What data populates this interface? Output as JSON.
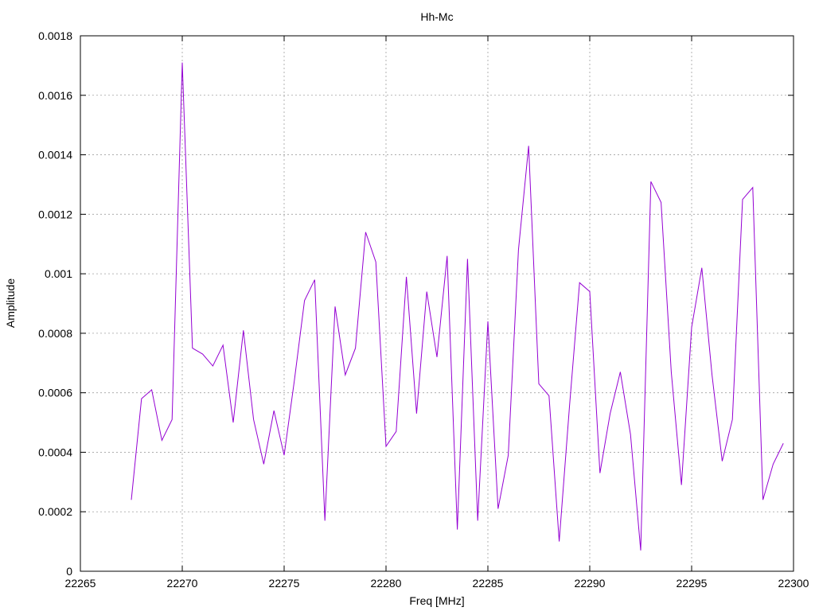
{
  "chart_data": {
    "type": "line",
    "title": "Hh-Mc",
    "xlabel": "Freq [MHz]",
    "ylabel": "Amplitude",
    "xlim": [
      22265,
      22300
    ],
    "ylim": [
      0,
      0.0018
    ],
    "xticks": [
      22265,
      22270,
      22275,
      22280,
      22285,
      22290,
      22295,
      22300
    ],
    "xtick_labels": [
      "22265",
      "22270",
      "22275",
      "22280",
      "22285",
      "22290",
      "22295",
      "22300"
    ],
    "yticks": [
      0,
      0.0002,
      0.0004,
      0.0006,
      0.0008,
      0.001,
      0.0012,
      0.0014,
      0.0016,
      0.0018
    ],
    "ytick_labels": [
      "0",
      "0.0002",
      "0.0004",
      "0.0006",
      "0.0008",
      "0.001",
      "0.0012",
      "0.0014",
      "0.0016",
      "0.0018"
    ],
    "grid": true,
    "legend": "none",
    "series": [
      {
        "color": "#9400d3",
        "x": [
          22267.5,
          22268.0,
          22268.5,
          22269.0,
          22269.5,
          22270.0,
          22270.5,
          22271.0,
          22271.5,
          22272.0,
          22272.5,
          22273.0,
          22273.5,
          22274.0,
          22274.5,
          22275.0,
          22275.5,
          22276.0,
          22276.5,
          22277.0,
          22277.5,
          22278.0,
          22278.5,
          22279.0,
          22279.5,
          22280.0,
          22280.5,
          22281.0,
          22281.5,
          22282.0,
          22282.5,
          22283.0,
          22283.5,
          22284.0,
          22284.5,
          22285.0,
          22285.5,
          22286.0,
          22286.5,
          22287.0,
          22287.5,
          22288.0,
          22288.5,
          22289.0,
          22289.5,
          22290.0,
          22290.5,
          22291.0,
          22291.5,
          22292.0,
          22292.5,
          22293.0,
          22293.5,
          22294.0,
          22294.5,
          22295.0,
          22295.5,
          22296.0,
          22296.5,
          22297.0,
          22297.5,
          22298.0,
          22298.5,
          22299.0,
          22299.5
        ],
        "y": [
          0.00024,
          0.00058,
          0.00061,
          0.00044,
          0.00051,
          0.00171,
          0.00075,
          0.00073,
          0.00069,
          0.00076,
          0.0005,
          0.00081,
          0.00051,
          0.00036,
          0.00054,
          0.00039,
          0.00064,
          0.00091,
          0.00098,
          0.00017,
          0.00089,
          0.00066,
          0.00075,
          0.00114,
          0.00104,
          0.00042,
          0.00047,
          0.00099,
          0.00053,
          0.00094,
          0.00072,
          0.00106,
          0.00014,
          0.00105,
          0.00017,
          0.00084,
          0.00021,
          0.00039,
          0.00108,
          0.00143,
          0.00063,
          0.00059,
          0.0001,
          0.00055,
          0.00097,
          0.00094,
          0.00033,
          0.00053,
          0.00067,
          0.00046,
          7e-05,
          0.00131,
          0.00124,
          0.00067,
          0.00029,
          0.00082,
          0.00102,
          0.00066,
          0.00037,
          0.00051,
          0.00125,
          0.00129,
          0.00024,
          0.00036,
          0.00043
        ]
      }
    ]
  }
}
